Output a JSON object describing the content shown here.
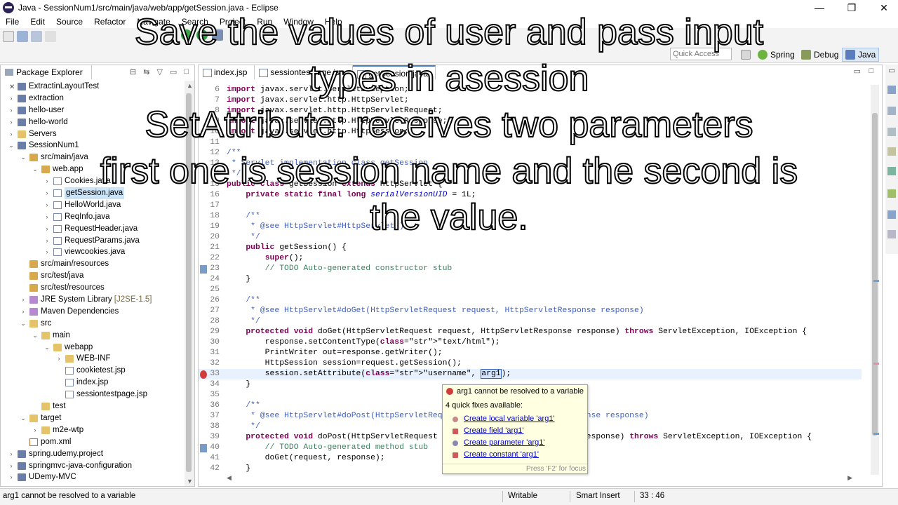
{
  "window": {
    "title": "Java - SessionNum1/src/main/java/web/app/getSession.java - Eclipse",
    "minimize": "—",
    "maximize": "❐",
    "close": "✕"
  },
  "menu": [
    "File",
    "Edit",
    "Source",
    "Refactor",
    "Navigate",
    "Search",
    "Project",
    "Run",
    "Window",
    "Help"
  ],
  "toolbar": {
    "quick_access_placeholder": "Quick Access",
    "perspectives": [
      "Spring",
      "Debug",
      "Java"
    ],
    "active_perspective": "Java"
  },
  "explorer": {
    "tab_label": "Package Explorer",
    "tab_close": "✕",
    "tree": [
      {
        "label": "ExtractinLayoutTest",
        "indent": 0,
        "toggle": "›",
        "icon": "project"
      },
      {
        "label": "extraction",
        "indent": 0,
        "toggle": "›",
        "icon": "project"
      },
      {
        "label": "hello-user",
        "indent": 0,
        "toggle": "›",
        "icon": "project"
      },
      {
        "label": "hello-world",
        "indent": 0,
        "toggle": "›",
        "icon": "project"
      },
      {
        "label": "Servers",
        "indent": 0,
        "toggle": "›",
        "icon": "folder"
      },
      {
        "label": "SessionNum1",
        "indent": 0,
        "toggle": "⌄",
        "icon": "project"
      },
      {
        "label": "src/main/java",
        "indent": 1,
        "toggle": "⌄",
        "icon": "pkgfolder"
      },
      {
        "label": "web.app",
        "indent": 2,
        "toggle": "⌄",
        "icon": "pkgfolder"
      },
      {
        "label": "Cookies.java",
        "indent": 3,
        "toggle": "›",
        "icon": "java"
      },
      {
        "label": "getSession.java",
        "indent": 3,
        "toggle": "›",
        "icon": "java",
        "selected": true
      },
      {
        "label": "HelloWorld.java",
        "indent": 3,
        "toggle": "›",
        "icon": "java"
      },
      {
        "label": "ReqInfo.java",
        "indent": 3,
        "toggle": "›",
        "icon": "java"
      },
      {
        "label": "RequestHeader.java",
        "indent": 3,
        "toggle": "›",
        "icon": "java"
      },
      {
        "label": "RequestParams.java",
        "indent": 3,
        "toggle": "›",
        "icon": "java"
      },
      {
        "label": "viewcookies.java",
        "indent": 3,
        "toggle": "›",
        "icon": "java"
      },
      {
        "label": "src/main/resources",
        "indent": 1,
        "toggle": "",
        "icon": "pkgfolder"
      },
      {
        "label": "src/test/java",
        "indent": 1,
        "toggle": "",
        "icon": "pkgfolder"
      },
      {
        "label": "src/test/resources",
        "indent": 1,
        "toggle": "",
        "icon": "pkgfolder"
      },
      {
        "label": "JRE System Library",
        "deco": " [J2SE-1.5]",
        "indent": 1,
        "toggle": "›",
        "icon": "lib"
      },
      {
        "label": "Maven Dependencies",
        "indent": 1,
        "toggle": "›",
        "icon": "lib"
      },
      {
        "label": "src",
        "indent": 1,
        "toggle": "⌄",
        "icon": "folder"
      },
      {
        "label": "main",
        "indent": 2,
        "toggle": "⌄",
        "icon": "folder"
      },
      {
        "label": "webapp",
        "indent": 3,
        "toggle": "⌄",
        "icon": "folder"
      },
      {
        "label": "WEB-INF",
        "indent": 4,
        "toggle": "›",
        "icon": "folder"
      },
      {
        "label": "cookietest.jsp",
        "indent": 4,
        "toggle": "",
        "icon": "jsp"
      },
      {
        "label": "index.jsp",
        "indent": 4,
        "toggle": "",
        "icon": "jsp"
      },
      {
        "label": "sessiontestpage.jsp",
        "indent": 4,
        "toggle": "",
        "icon": "jsp"
      },
      {
        "label": "test",
        "indent": 2,
        "toggle": "",
        "icon": "folder"
      },
      {
        "label": "target",
        "indent": 1,
        "toggle": "⌄",
        "icon": "folder"
      },
      {
        "label": "m2e-wtp",
        "indent": 2,
        "toggle": "›",
        "icon": "folder"
      },
      {
        "label": "pom.xml",
        "indent": 1,
        "toggle": "",
        "icon": "xml"
      },
      {
        "label": "spring.udemy.project",
        "indent": 0,
        "toggle": "›",
        "icon": "project"
      },
      {
        "label": "springmvc-java-configuration",
        "indent": 0,
        "toggle": "›",
        "icon": "project"
      },
      {
        "label": "UDemy-MVC",
        "indent": 0,
        "toggle": "›",
        "icon": "project"
      }
    ]
  },
  "editor": {
    "tabs": [
      "index.jsp",
      "sessiontestpage.jsp",
      "getSession.java"
    ],
    "active_tab": "getSession.java",
    "lines": [
      {
        "n": "6",
        "text": "import javax.servlet.ServletException;"
      },
      {
        "n": "7",
        "text": "import javax.servlet.http.HttpServlet;"
      },
      {
        "n": "8",
        "text": "import javax.servlet.http.HttpServletRequest;"
      },
      {
        "n": "9",
        "text": "import javax.servlet.http.HttpServletResponse;"
      },
      {
        "n": "10",
        "text": "import javax.servlet.http.HttpSession;"
      },
      {
        "n": "11",
        "text": ""
      },
      {
        "n": "12",
        "text": "/**"
      },
      {
        "n": "13",
        "text": " * Servlet implementation class getSession"
      },
      {
        "n": "14",
        "text": " */"
      },
      {
        "n": "15",
        "text": "public class getSession extends HttpServlet {"
      },
      {
        "n": "16",
        "text": "    private static final long serialVersionUID = 1L;"
      },
      {
        "n": "17",
        "text": ""
      },
      {
        "n": "18",
        "text": "    /**"
      },
      {
        "n": "19",
        "text": "     * @see HttpServlet#HttpServlet()"
      },
      {
        "n": "20",
        "text": "     */"
      },
      {
        "n": "21",
        "text": "    public getSession() {"
      },
      {
        "n": "22",
        "text": "        super();"
      },
      {
        "n": "23",
        "text": "        // TODO Auto-generated constructor stub"
      },
      {
        "n": "24",
        "text": "    }"
      },
      {
        "n": "25",
        "text": ""
      },
      {
        "n": "26",
        "text": "    /**"
      },
      {
        "n": "27",
        "text": "     * @see HttpServlet#doGet(HttpServletRequest request, HttpServletResponse response)"
      },
      {
        "n": "28",
        "text": "     */"
      },
      {
        "n": "29",
        "text": "    protected void doGet(HttpServletRequest request, HttpServletResponse response) throws ServletException, IOException {"
      },
      {
        "n": "30",
        "text": "        response.setContentType(\"text/html\");"
      },
      {
        "n": "31",
        "text": "        PrintWriter out=response.getWriter();"
      },
      {
        "n": "32",
        "text": "        HttpSession session=request.getSession();"
      },
      {
        "n": "33",
        "text": "        session.setAttribute(\"username\", arg1);"
      },
      {
        "n": "34",
        "text": "    }"
      },
      {
        "n": "35",
        "text": ""
      },
      {
        "n": "36",
        "text": "    /**"
      },
      {
        "n": "37",
        "text": "     * @see HttpServlet#doPost(HttpServletRequest request, HttpServletResponse response)"
      },
      {
        "n": "38",
        "text": "     */"
      },
      {
        "n": "39",
        "text": "    protected void doPost(HttpServletRequest request, HttpServletResponse response) throws ServletException, IOException {"
      },
      {
        "n": "40",
        "text": "        // TODO Auto-generated method stub"
      },
      {
        "n": "41",
        "text": "        doGet(request, response);"
      },
      {
        "n": "42",
        "text": "    }"
      }
    ]
  },
  "quickfix": {
    "problem": "arg1 cannot be resolved to a variable",
    "count_label": "4 quick fixes available:",
    "fixes": [
      "Create local variable 'arg1'",
      "Create field 'arg1'",
      "Create parameter 'arg1'",
      "Create constant 'arg1'"
    ],
    "focus_hint": "Press 'F2' for focus"
  },
  "status": {
    "message": "arg1 cannot be resolved to a variable",
    "writable": "Writable",
    "insert_mode": "Smart Insert",
    "position": "33 : 46"
  },
  "captions": [
    "Save the values of user and pass input",
    "types in asession",
    "SetAttribute: receives two parameters",
    "first one is session name and the second is",
    "the value."
  ],
  "colors": {
    "keyword": "#7f0055",
    "comment": "#3f7f5f",
    "javadoc": "#3f5fbf",
    "string": "#2a00ff",
    "link": "#0000cc",
    "error": "#d23b3b"
  }
}
